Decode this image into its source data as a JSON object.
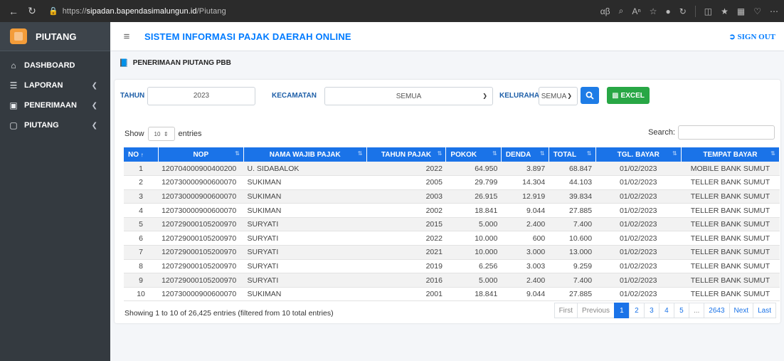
{
  "browser": {
    "url_prefix": "https://",
    "url_host": "sipadan.bapendasimalungun.id",
    "url_path": "/Piutang"
  },
  "sidebar": {
    "brand": "PIUTANG",
    "items": [
      {
        "label": "DASHBOARD",
        "icon": "home-icon",
        "has_arrow": false
      },
      {
        "label": "LAPORAN",
        "icon": "database-icon",
        "has_arrow": true
      },
      {
        "label": "PENERIMAAN",
        "icon": "inbox-icon",
        "has_arrow": true
      },
      {
        "label": "PIUTANG",
        "icon": "folder-icon",
        "has_arrow": true
      }
    ]
  },
  "header": {
    "title": "SISTEM INFORMASI PAJAK DAERAH ONLINE",
    "signout": "SIGN OUT"
  },
  "page": {
    "title": "PENERIMAAN PIUTANG PBB"
  },
  "filters": {
    "tahun_label": "TAHUN",
    "tahun_value": "2023",
    "kecamatan_label": "KECAMATAN",
    "kecamatan_value": "SEMUA",
    "kelurahan_label": "KELURAHAN",
    "kelurahan_value": "SEMUA",
    "excel_label": "EXCEL"
  },
  "datatable": {
    "show_label": "Show",
    "length_value": "10",
    "entries_label": "entries",
    "search_label": "Search:",
    "columns": [
      "NO",
      "NOP",
      "NAMA WAJIB PAJAK",
      "TAHUN PAJAK",
      "POKOK",
      "DENDA",
      "TOTAL",
      "TGL. BAYAR",
      "TEMPAT BAYAR"
    ],
    "rows": [
      [
        "1",
        "120704000900400200",
        "U. SIDABALOK",
        "2022",
        "64.950",
        "3.897",
        "68.847",
        "01/02/2023",
        "MOBILE BANK SUMUT"
      ],
      [
        "2",
        "120730000900600070",
        "SUKIMAN",
        "2005",
        "29.799",
        "14.304",
        "44.103",
        "01/02/2023",
        "TELLER BANK SUMUT"
      ],
      [
        "3",
        "120730000900600070",
        "SUKIMAN",
        "2003",
        "26.915",
        "12.919",
        "39.834",
        "01/02/2023",
        "TELLER BANK SUMUT"
      ],
      [
        "4",
        "120730000900600070",
        "SUKIMAN",
        "2002",
        "18.841",
        "9.044",
        "27.885",
        "01/02/2023",
        "TELLER BANK SUMUT"
      ],
      [
        "5",
        "120729000105200970",
        "SURYATI",
        "2015",
        "5.000",
        "2.400",
        "7.400",
        "01/02/2023",
        "TELLER BANK SUMUT"
      ],
      [
        "6",
        "120729000105200970",
        "SURYATI",
        "2022",
        "10.000",
        "600",
        "10.600",
        "01/02/2023",
        "TELLER BANK SUMUT"
      ],
      [
        "7",
        "120729000105200970",
        "SURYATI",
        "2021",
        "10.000",
        "3.000",
        "13.000",
        "01/02/2023",
        "TELLER BANK SUMUT"
      ],
      [
        "8",
        "120729000105200970",
        "SURYATI",
        "2019",
        "6.256",
        "3.003",
        "9.259",
        "01/02/2023",
        "TELLER BANK SUMUT"
      ],
      [
        "9",
        "120729000105200970",
        "SURYATI",
        "2016",
        "5.000",
        "2.400",
        "7.400",
        "01/02/2023",
        "TELLER BANK SUMUT"
      ],
      [
        "10",
        "120730000900600070",
        "SUKIMAN",
        "2001",
        "18.841",
        "9.044",
        "27.885",
        "01/02/2023",
        "TELLER BANK SUMUT"
      ]
    ],
    "info": "Showing 1 to 10 of 26,425 entries (filtered from 10 total entries)",
    "pagination": [
      {
        "label": "First",
        "state": "disabled"
      },
      {
        "label": "Previous",
        "state": "disabled"
      },
      {
        "label": "1",
        "state": "active"
      },
      {
        "label": "2",
        "state": ""
      },
      {
        "label": "3",
        "state": ""
      },
      {
        "label": "4",
        "state": ""
      },
      {
        "label": "5",
        "state": ""
      },
      {
        "label": "...",
        "state": "disabled"
      },
      {
        "label": "2643",
        "state": ""
      },
      {
        "label": "Next",
        "state": ""
      },
      {
        "label": "Last",
        "state": ""
      }
    ]
  },
  "colors": {
    "primary": "#1a73e8",
    "sidebar": "#343a40",
    "excel": "#28a745",
    "brand": "#f39c39"
  }
}
